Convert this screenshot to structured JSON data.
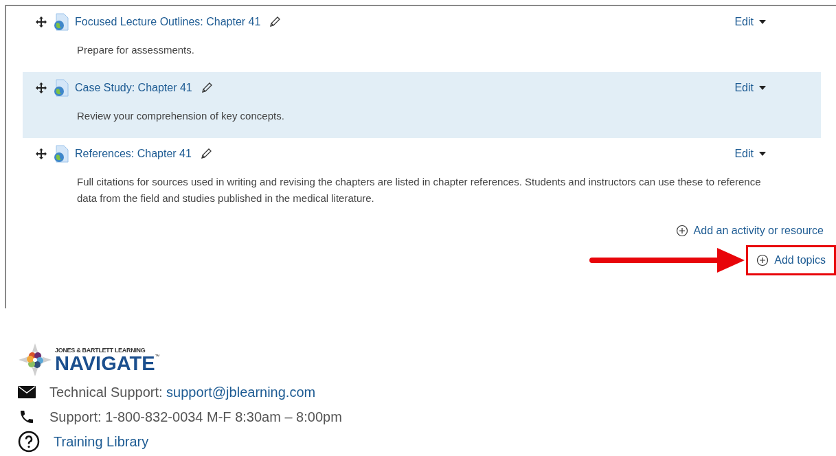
{
  "activities": [
    {
      "title": "Focused Lecture Outlines: Chapter 41",
      "description": "Prepare for assessments.",
      "edit": "Edit",
      "highlighted": false
    },
    {
      "title": "Case Study: Chapter 41",
      "description": "Review your comprehension of key concepts.",
      "edit": "Edit",
      "highlighted": true
    },
    {
      "title": "References: Chapter 41",
      "description": "Full citations for sources used in writing and revising the chapters are listed in chapter references. Students and instructors can use these to reference data from the field and studies published in the medical literature.",
      "edit": "Edit",
      "highlighted": false
    }
  ],
  "add_activity": "Add an activity or resource",
  "add_topics": "Add topics",
  "footer": {
    "logo_top": "JONES & BARTLETT LEARNING",
    "logo_main": "NAVIGATE",
    "logo_tm": "™",
    "email_label": "Technical Support:",
    "email": "support@jblearning.com",
    "phone": "Support: 1-800-832-0034 M-F 8:30am – 8:00pm",
    "training": "Training Library"
  }
}
